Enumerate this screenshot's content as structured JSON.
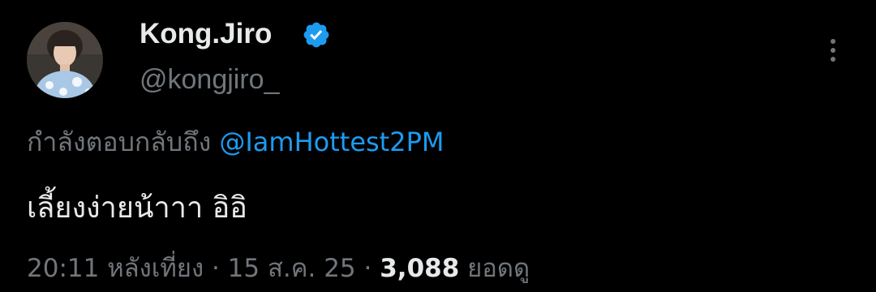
{
  "author": {
    "display_name": "Kong.Jiro",
    "handle": "@kongjiro_",
    "verified": true,
    "avatar_icon": "profile-photo"
  },
  "tweet": {
    "reply_prefix": "กำลังตอบกลับถึง",
    "reply_mention": "@IamHottest2PM",
    "text": "เลี้ยงง่ายน้าาา อิอิ",
    "time": "20:11 หลังเที่ยง",
    "separator": "·",
    "date": "15 ส.ค. 25",
    "views_count": "3,088",
    "views_label": "ยอดดู"
  },
  "colors": {
    "background": "#000000",
    "text_primary": "#e7e9ea",
    "text_secondary": "#71767b",
    "link": "#1d9bf0",
    "verified_badge": "#1d9bf0"
  },
  "icons": {
    "verified": "verified-badge-icon",
    "more": "more-options-icon"
  }
}
